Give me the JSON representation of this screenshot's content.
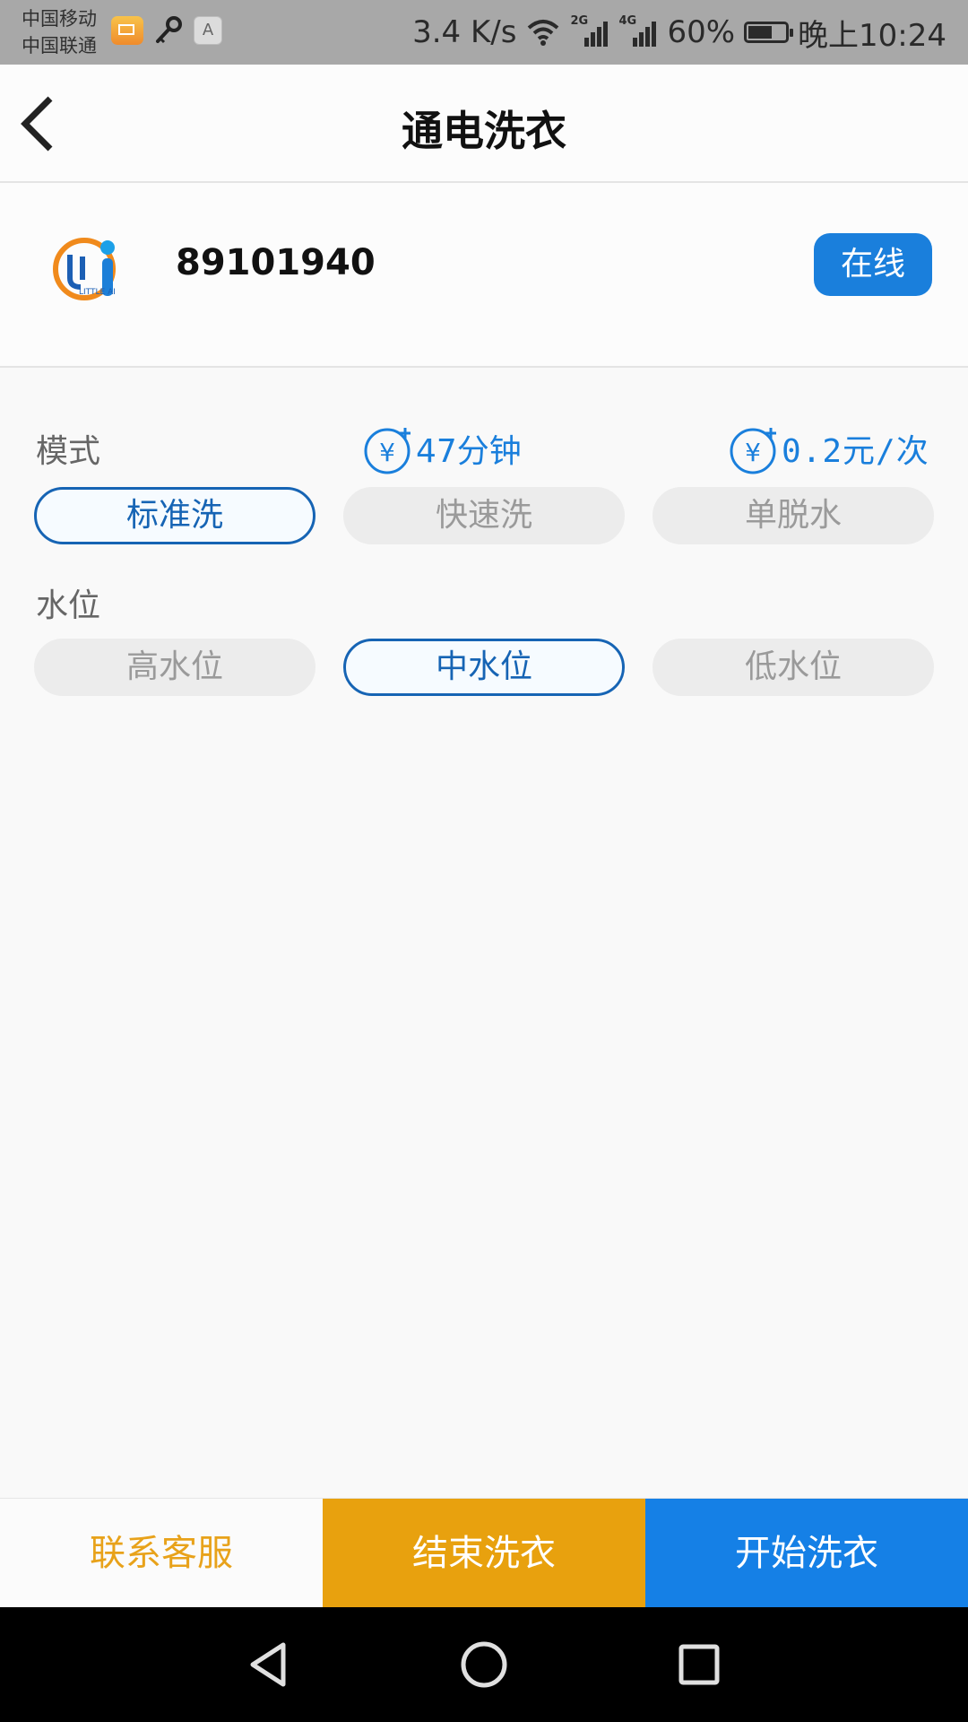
{
  "status_bar": {
    "carrier_1": "中国移动",
    "carrier_2": "中国联通",
    "notification_icons": [
      "mail-icon",
      "key-icon",
      "font-a-icon"
    ],
    "network_speed": "3.4 K/s",
    "signal_1_label": "2G",
    "signal_2_label": "4G",
    "battery": "60%",
    "time": "晚上10:24"
  },
  "header": {
    "title": "通电洗衣",
    "back_icon": "chevron-left-icon"
  },
  "device": {
    "logo_text": "LITTLE AI",
    "id": "89101940",
    "status": "在线"
  },
  "wash": {
    "mode_label": "模式",
    "duration": "47分钟",
    "price": "0.2元/次",
    "modes": [
      {
        "label": "标准洗",
        "selected": true
      },
      {
        "label": "快速洗",
        "selected": false
      },
      {
        "label": "单脱水",
        "selected": false
      }
    ],
    "water_label": "水位",
    "water_levels": [
      {
        "label": "高水位",
        "selected": false
      },
      {
        "label": "中水位",
        "selected": true
      },
      {
        "label": "低水位",
        "selected": false
      }
    ]
  },
  "actions": {
    "service": "联系客服",
    "end": "结束洗衣",
    "start": "开始洗衣"
  },
  "nav": {
    "icons": [
      "back-triangle-icon",
      "home-circle-icon",
      "recents-square-icon"
    ]
  },
  "colors": {
    "accent": "#1a7fdc",
    "selected_border": "#1664b4",
    "orange": "#e8a10e",
    "start_blue": "#1580e6"
  }
}
